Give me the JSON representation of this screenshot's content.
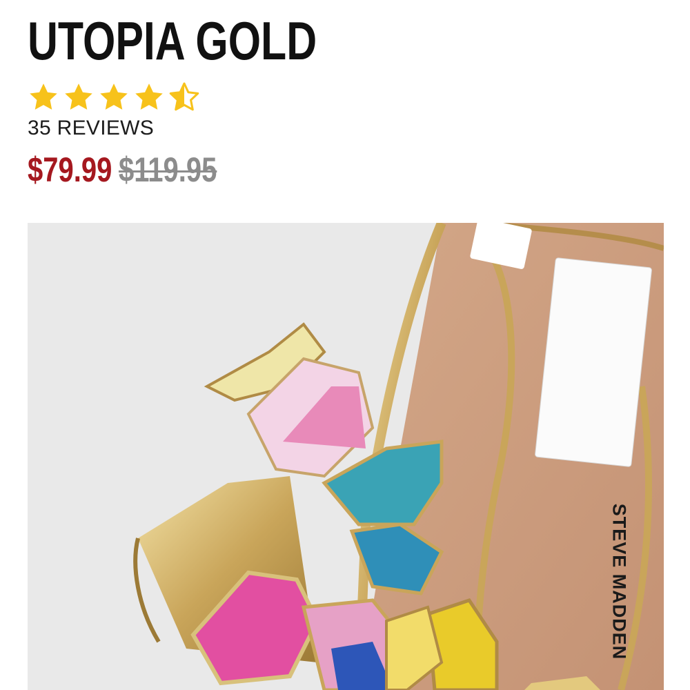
{
  "product": {
    "title": "UTOPIA GOLD",
    "rating": 4.5,
    "rating_max": 5,
    "reviews_label": "35 REVIEWS",
    "price_sale": "$79.99",
    "price_original": "$119.95",
    "brand_label": "STEVE MADDEN"
  },
  "image": {
    "alt": "Gold heeled sandal with colorful butterfly appliqués",
    "icon": "product-photo"
  },
  "colors": {
    "star": "#f7c21b",
    "sale_price": "#a5181f",
    "original_price": "#8c8c8c",
    "title": "#111111",
    "image_background": "#e9e9e9"
  }
}
